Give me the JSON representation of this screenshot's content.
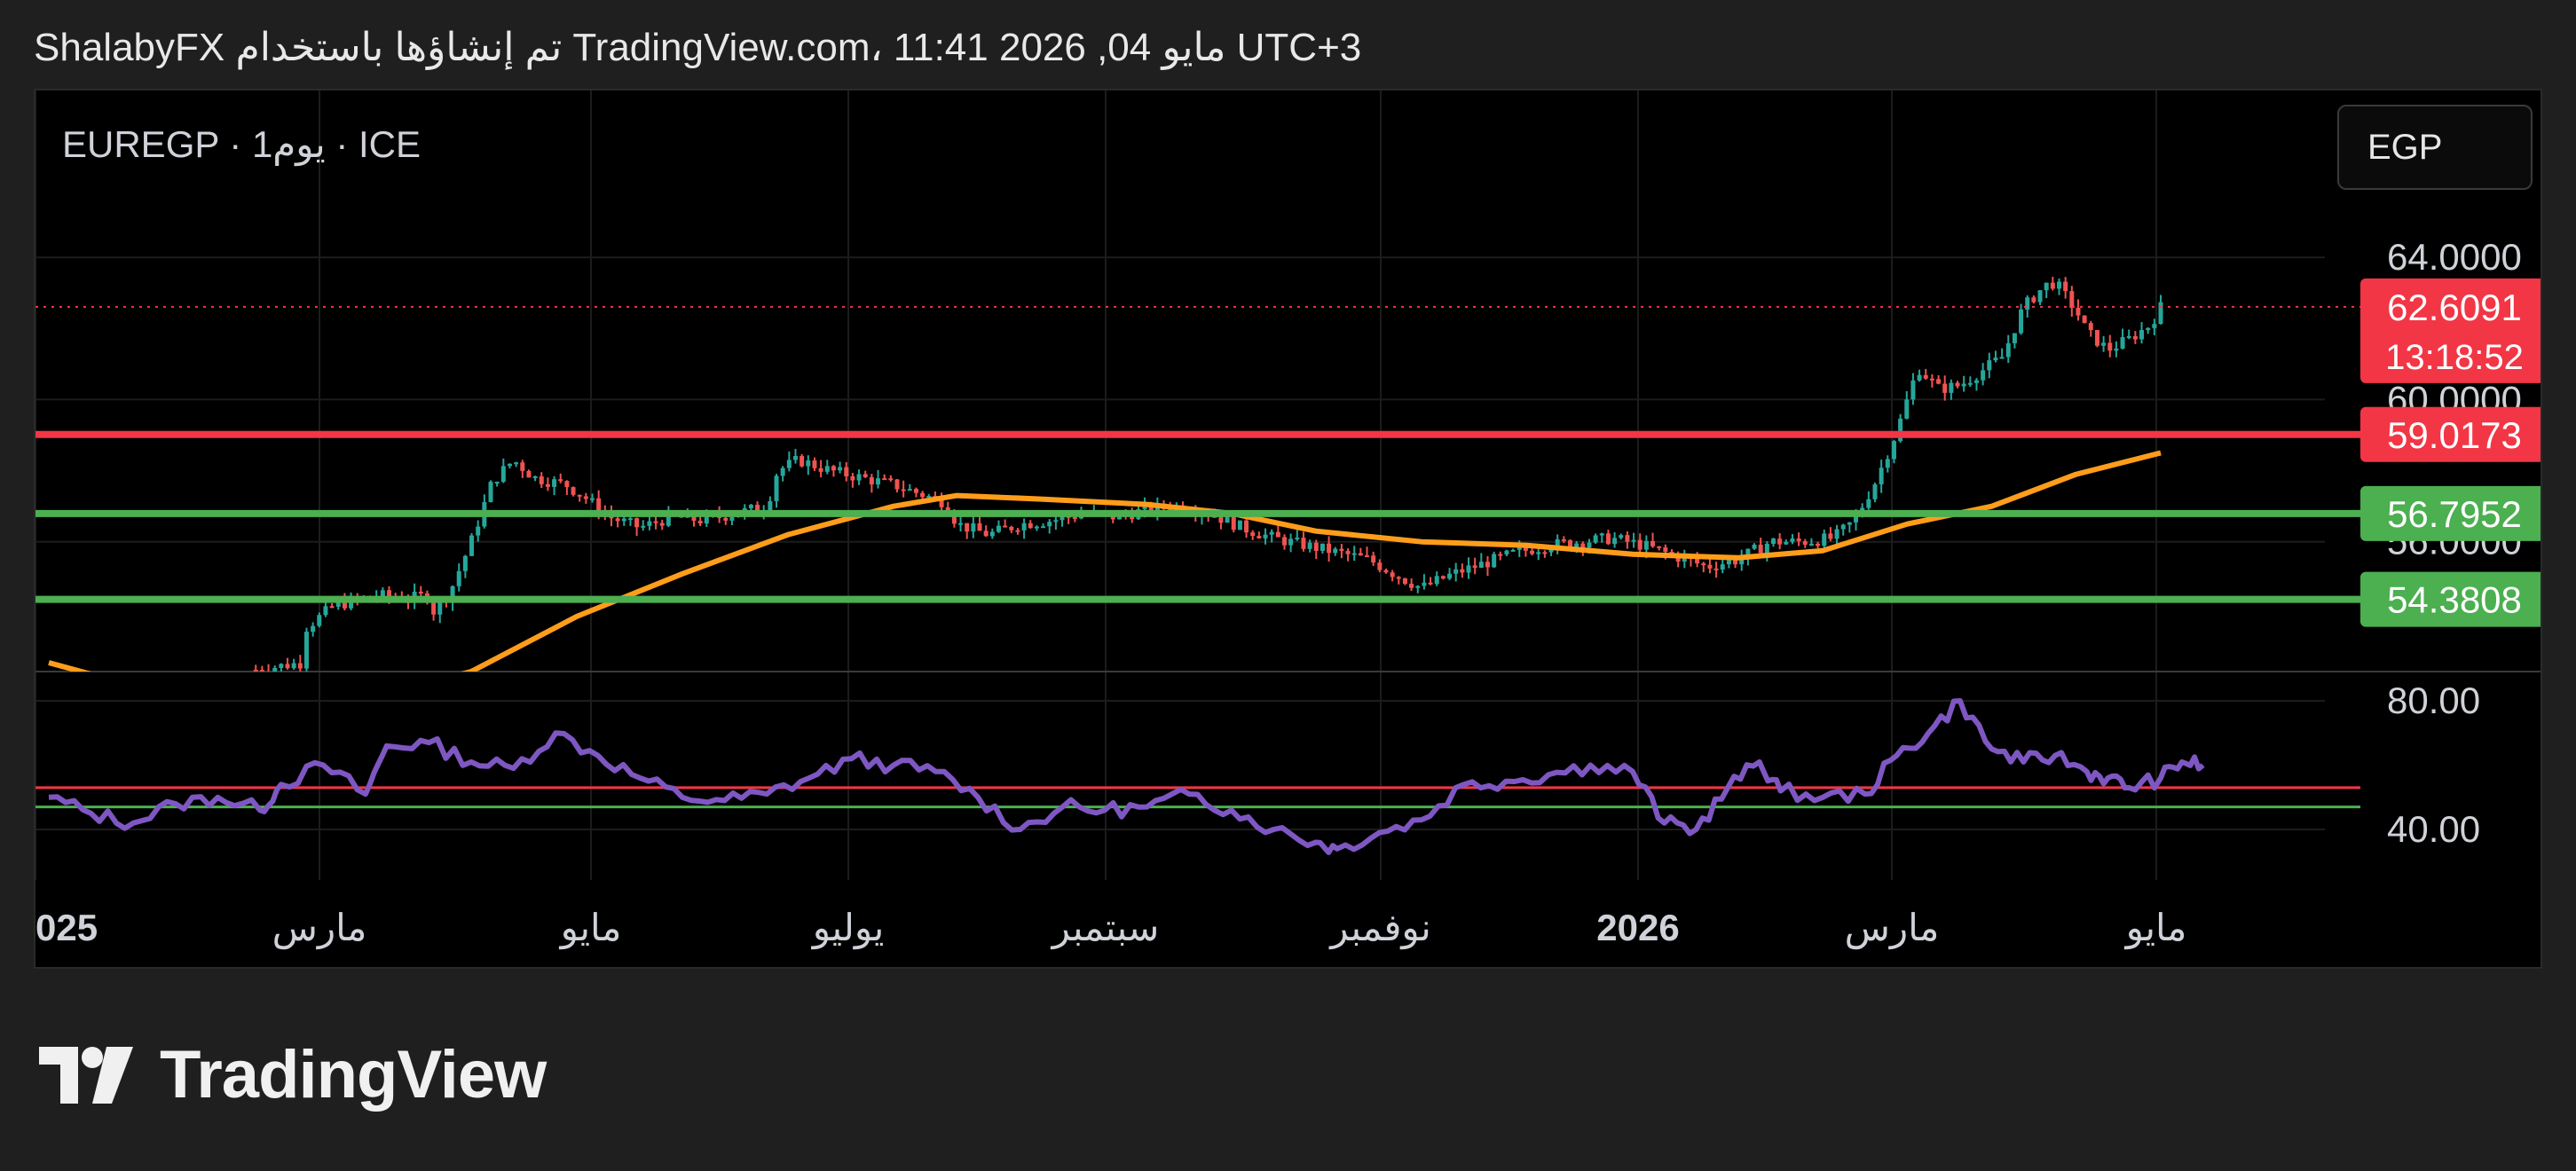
{
  "header": {
    "attribution": "ShalabyFX تم إنشاؤها باستخدام TradingView.com، 11:41 2026 ,04 مايو UTC+3"
  },
  "chart_panel": {
    "symbol": "EUREGP · 1يوم · ICE",
    "currency_button": "EGP"
  },
  "colors": {
    "up": "#26a69a",
    "down": "#ef5350",
    "ma_line": "#ff9d1a",
    "rsi_line": "#7e57c2",
    "resistance": "#f23645",
    "support": "#4caf50",
    "price_tag": "#f23645",
    "grid": "#1c1c1c",
    "axis_text": "#cfd2d8"
  },
  "chart_data": {
    "type": "candlestick",
    "symbol": "EUREGP",
    "x_tick_labels": [
      "025",
      "مارس",
      "مايو",
      "يوليو",
      "سبتمبر",
      "نوفمبر",
      "2026",
      "مارس",
      "مايو"
    ],
    "price_axis": {
      "ylim": [
        52.35,
        65.7
      ],
      "tick_labels": [
        "64.0000",
        "60.0000",
        "56.0000"
      ],
      "ticks": [
        64,
        60,
        56
      ]
    },
    "current_price": {
      "value": 62.6091,
      "label": "62.6091",
      "countdown": "13:18:52"
    },
    "horizontal_levels": [
      {
        "value": 59.0173,
        "label": "59.0173",
        "color": "#f23645"
      },
      {
        "value": 56.7952,
        "label": "56.7952",
        "color": "#4caf50"
      },
      {
        "value": 54.3808,
        "label": "54.3808",
        "color": "#4caf50"
      }
    ],
    "price_path": [
      [
        0.098,
        52.4
      ],
      [
        0.12,
        52.6
      ],
      [
        0.122,
        53.6
      ],
      [
        0.135,
        54.2
      ],
      [
        0.155,
        54.5
      ],
      [
        0.17,
        54.4
      ],
      [
        0.18,
        54.5
      ],
      [
        0.18,
        53.9
      ],
      [
        0.19,
        54.6
      ],
      [
        0.2,
        56.0
      ],
      [
        0.21,
        57.7
      ],
      [
        0.22,
        58.3
      ],
      [
        0.23,
        57.8
      ],
      [
        0.245,
        57.6
      ],
      [
        0.255,
        57.2
      ],
      [
        0.265,
        56.7
      ],
      [
        0.28,
        56.4
      ],
      [
        0.295,
        56.7
      ],
      [
        0.31,
        56.6
      ],
      [
        0.325,
        56.8
      ],
      [
        0.34,
        57.0
      ],
      [
        0.345,
        58.0
      ],
      [
        0.355,
        58.3
      ],
      [
        0.37,
        58.0
      ],
      [
        0.385,
        57.8
      ],
      [
        0.4,
        57.6
      ],
      [
        0.41,
        57.4
      ],
      [
        0.425,
        57.1
      ],
      [
        0.43,
        56.5
      ],
      [
        0.445,
        56.2
      ],
      [
        0.46,
        56.5
      ],
      [
        0.475,
        56.6
      ],
      [
        0.49,
        56.8
      ],
      [
        0.505,
        56.7
      ],
      [
        0.52,
        56.9
      ],
      [
        0.535,
        57.0
      ],
      [
        0.55,
        56.8
      ],
      [
        0.565,
        56.4
      ],
      [
        0.58,
        56.1
      ],
      [
        0.595,
        55.9
      ],
      [
        0.61,
        55.7
      ],
      [
        0.625,
        55.5
      ],
      [
        0.64,
        55.0
      ],
      [
        0.65,
        54.7
      ],
      [
        0.665,
        55.1
      ],
      [
        0.68,
        55.4
      ],
      [
        0.695,
        55.7
      ],
      [
        0.71,
        55.9
      ],
      [
        0.725,
        56.0
      ],
      [
        0.74,
        56.1
      ],
      [
        0.755,
        55.9
      ],
      [
        0.77,
        55.6
      ],
      [
        0.785,
        55.3
      ],
      [
        0.8,
        55.5
      ],
      [
        0.815,
        56.0
      ],
      [
        0.83,
        56.0
      ],
      [
        0.845,
        56.1
      ],
      [
        0.855,
        56.6
      ],
      [
        0.865,
        57.7
      ],
      [
        0.875,
        59.1
      ],
      [
        0.885,
        60.9
      ],
      [
        0.895,
        60.3
      ],
      [
        0.905,
        60.4
      ],
      [
        0.915,
        60.8
      ],
      [
        0.925,
        61.2
      ],
      [
        0.935,
        62.6
      ],
      [
        0.945,
        63.2
      ],
      [
        0.95,
        63.3
      ],
      [
        0.96,
        62.5
      ],
      [
        0.965,
        61.9
      ],
      [
        0.975,
        61.4
      ],
      [
        0.985,
        61.7
      ],
      [
        0.995,
        62.1
      ],
      [
        1.0,
        62.6
      ]
    ],
    "ma_path": [
      [
        0.0,
        52.6
      ],
      [
        0.08,
        51.3
      ],
      [
        0.16,
        51.7
      ],
      [
        0.2,
        52.35
      ],
      [
        0.25,
        53.9
      ],
      [
        0.3,
        55.1
      ],
      [
        0.35,
        56.2
      ],
      [
        0.4,
        57.0
      ],
      [
        0.43,
        57.3
      ],
      [
        0.47,
        57.2
      ],
      [
        0.52,
        57.05
      ],
      [
        0.56,
        56.8
      ],
      [
        0.6,
        56.3
      ],
      [
        0.65,
        56.0
      ],
      [
        0.7,
        55.9
      ],
      [
        0.75,
        55.65
      ],
      [
        0.8,
        55.55
      ],
      [
        0.84,
        55.75
      ],
      [
        0.88,
        56.5
      ],
      [
        0.92,
        57.0
      ],
      [
        0.96,
        57.9
      ],
      [
        1.0,
        58.5
      ]
    ],
    "rsi_panel": {
      "tick_labels": [
        "80.00",
        "40.00"
      ],
      "ticks": [
        80,
        40
      ],
      "levels": [
        {
          "value": 53,
          "color": "#f23645"
        },
        {
          "value": 47,
          "color": "#4caf50"
        }
      ],
      "path": [
        [
          0.0,
          50
        ],
        [
          0.02,
          45
        ],
        [
          0.04,
          42
        ],
        [
          0.06,
          48
        ],
        [
          0.08,
          50
        ],
        [
          0.1,
          46
        ],
        [
          0.11,
          54
        ],
        [
          0.13,
          60
        ],
        [
          0.15,
          51
        ],
        [
          0.16,
          66
        ],
        [
          0.18,
          67
        ],
        [
          0.2,
          61
        ],
        [
          0.22,
          59
        ],
        [
          0.24,
          70
        ],
        [
          0.26,
          63
        ],
        [
          0.28,
          56
        ],
        [
          0.3,
          50
        ],
        [
          0.32,
          49
        ],
        [
          0.34,
          51
        ],
        [
          0.36,
          56
        ],
        [
          0.38,
          62
        ],
        [
          0.4,
          60
        ],
        [
          0.42,
          58
        ],
        [
          0.44,
          50
        ],
        [
          0.46,
          40
        ],
        [
          0.48,
          47
        ],
        [
          0.5,
          46
        ],
        [
          0.52,
          47
        ],
        [
          0.54,
          51
        ],
        [
          0.56,
          46
        ],
        [
          0.58,
          40
        ],
        [
          0.6,
          36
        ],
        [
          0.61,
          34
        ],
        [
          0.63,
          39
        ],
        [
          0.65,
          43
        ],
        [
          0.67,
          54
        ],
        [
          0.69,
          55
        ],
        [
          0.71,
          57
        ],
        [
          0.73,
          60
        ],
        [
          0.75,
          58
        ],
        [
          0.765,
          42
        ],
        [
          0.78,
          40
        ],
        [
          0.795,
          53
        ],
        [
          0.81,
          61
        ],
        [
          0.82,
          52
        ],
        [
          0.84,
          50
        ],
        [
          0.86,
          51
        ],
        [
          0.875,
          63
        ],
        [
          0.89,
          70
        ],
        [
          0.905,
          80
        ],
        [
          0.92,
          65
        ],
        [
          0.935,
          61
        ],
        [
          0.95,
          63
        ],
        [
          0.965,
          58
        ],
        [
          0.975,
          56
        ],
        [
          0.985,
          53
        ],
        [
          1.0,
          56
        ],
        [
          1.01,
          61
        ],
        [
          1.02,
          60
        ]
      ]
    }
  },
  "brand": {
    "name": "TradingView"
  }
}
